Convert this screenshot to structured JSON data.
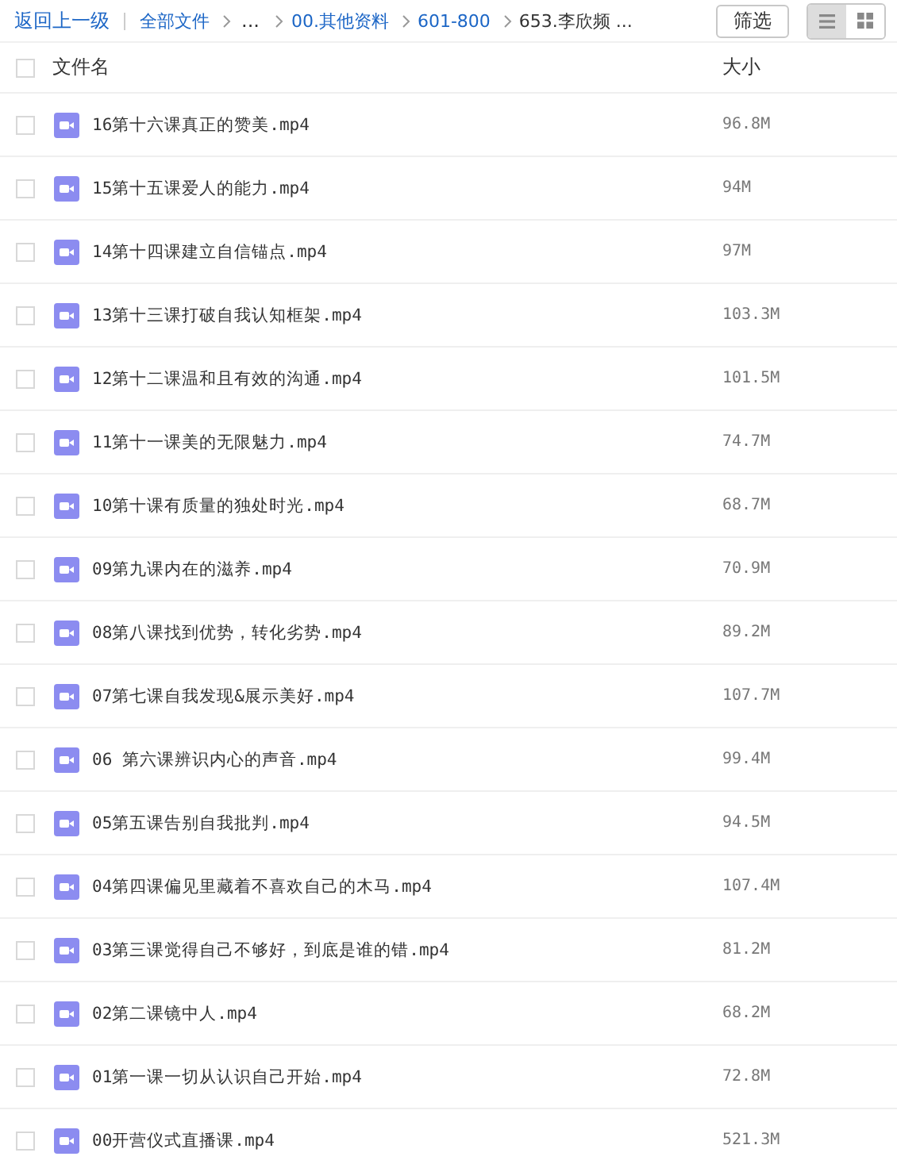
{
  "toolbar": {
    "back": "返回上一级",
    "breadcrumb": [
      {
        "label": "全部文件",
        "kind": "link"
      },
      {
        "label": "...",
        "kind": "ellipsis"
      },
      {
        "label": "00.其他资料",
        "kind": "link"
      },
      {
        "label": "601-800",
        "kind": "link"
      },
      {
        "label": "653.李欣频 ...",
        "kind": "current"
      }
    ],
    "filter_button": "筛选",
    "view_modes": [
      {
        "kind": "list",
        "selected": true
      },
      {
        "kind": "grid",
        "selected": false
      }
    ]
  },
  "table": {
    "columns": [
      "文件名",
      "大小"
    ],
    "select_all_checked": false,
    "rows": [
      {
        "name": "16第十六课真正的赞美.mp4",
        "size": "96.8M",
        "checked": false
      },
      {
        "name": "15第十五课爱人的能力.mp4",
        "size": "94M",
        "checked": false
      },
      {
        "name": "14第十四课建立自信锚点.mp4",
        "size": "97M",
        "checked": false
      },
      {
        "name": "13第十三课打破自我认知框架.mp4",
        "size": "103.3M",
        "checked": false
      },
      {
        "name": "12第十二课温和且有效的沟通.mp4",
        "size": "101.5M",
        "checked": false
      },
      {
        "name": "11第十一课美的无限魅力.mp4",
        "size": "74.7M",
        "checked": false
      },
      {
        "name": "10第十课有质量的独处时光.mp4",
        "size": "68.7M",
        "checked": false
      },
      {
        "name": "09第九课内在的滋养.mp4",
        "size": "70.9M",
        "checked": false
      },
      {
        "name": "08第八课找到优势，转化劣势.mp4",
        "size": "89.2M",
        "checked": false
      },
      {
        "name": "07第七课自我发现&展示美好.mp4",
        "size": "107.7M",
        "checked": false
      },
      {
        "name": "06 第六课辨识内心的声音.mp4",
        "size": "99.4M",
        "checked": false
      },
      {
        "name": "05第五课告别自我批判.mp4",
        "size": "94.5M",
        "checked": false
      },
      {
        "name": "04第四课偏见里藏着不喜欢自己的木马.mp4",
        "size": "107.4M",
        "checked": false
      },
      {
        "name": "03第三课觉得自己不够好，到底是谁的错.mp4",
        "size": "81.2M",
        "checked": false
      },
      {
        "name": "02第二课镜中人.mp4",
        "size": "68.2M",
        "checked": false
      },
      {
        "name": "01第一课一切从认识自己开始.mp4",
        "size": "72.8M",
        "checked": false
      },
      {
        "name": "00开营仪式直播课.mp4",
        "size": "521.3M",
        "checked": false
      }
    ]
  }
}
